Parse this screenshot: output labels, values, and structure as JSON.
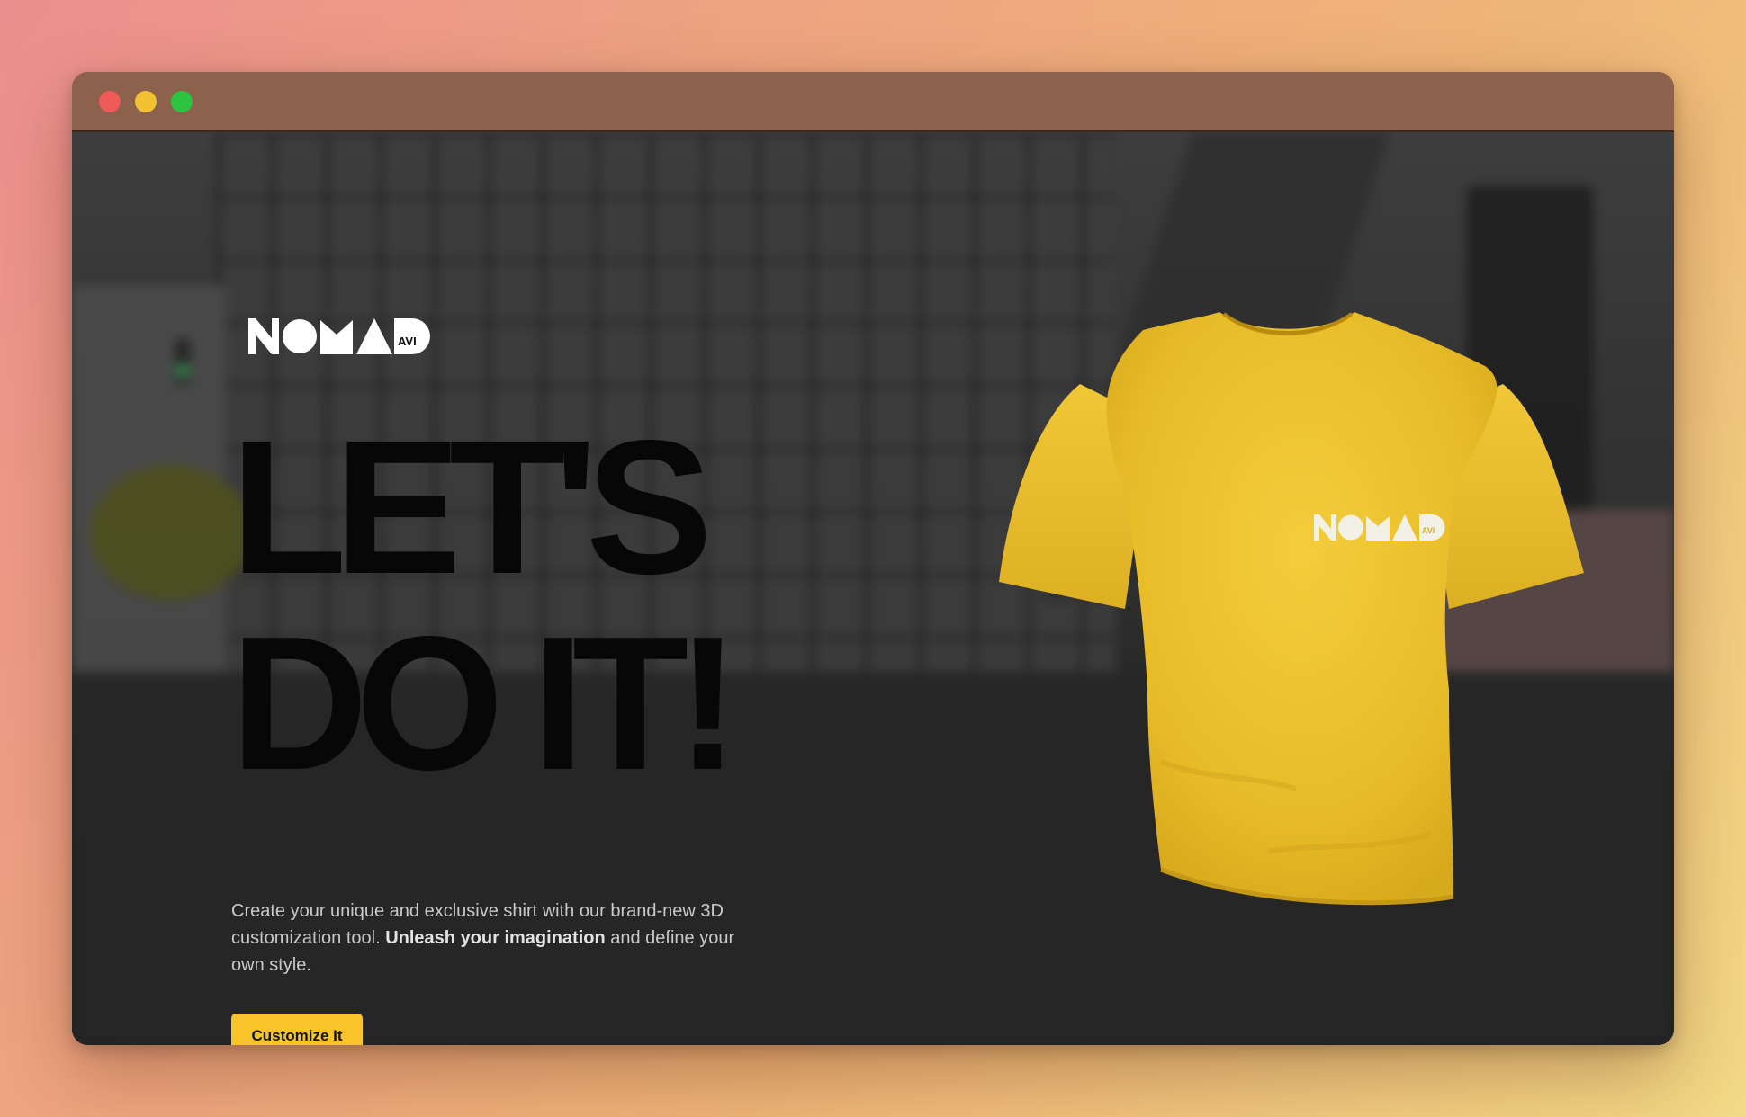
{
  "window": {
    "controls": [
      "close",
      "minimize",
      "maximize"
    ]
  },
  "brand": {
    "logo_text": "NOMAD",
    "logo_suffix": "AVI"
  },
  "hero": {
    "headline_line1": "LET'S",
    "headline_line2": "DO IT!",
    "description_part1": "Create your unique and exclusive shirt with our brand-new 3D customization tool.",
    "description_bold": "Unleash your imagination",
    "description_part2": "and define your own style.",
    "cta_label": "Customize It"
  },
  "product": {
    "shirt_color": "#f2c735",
    "shirt_print": "NOMAD AVI"
  },
  "colors": {
    "accent": "#f9c32b",
    "headline": "#070707",
    "background": "#222222"
  }
}
